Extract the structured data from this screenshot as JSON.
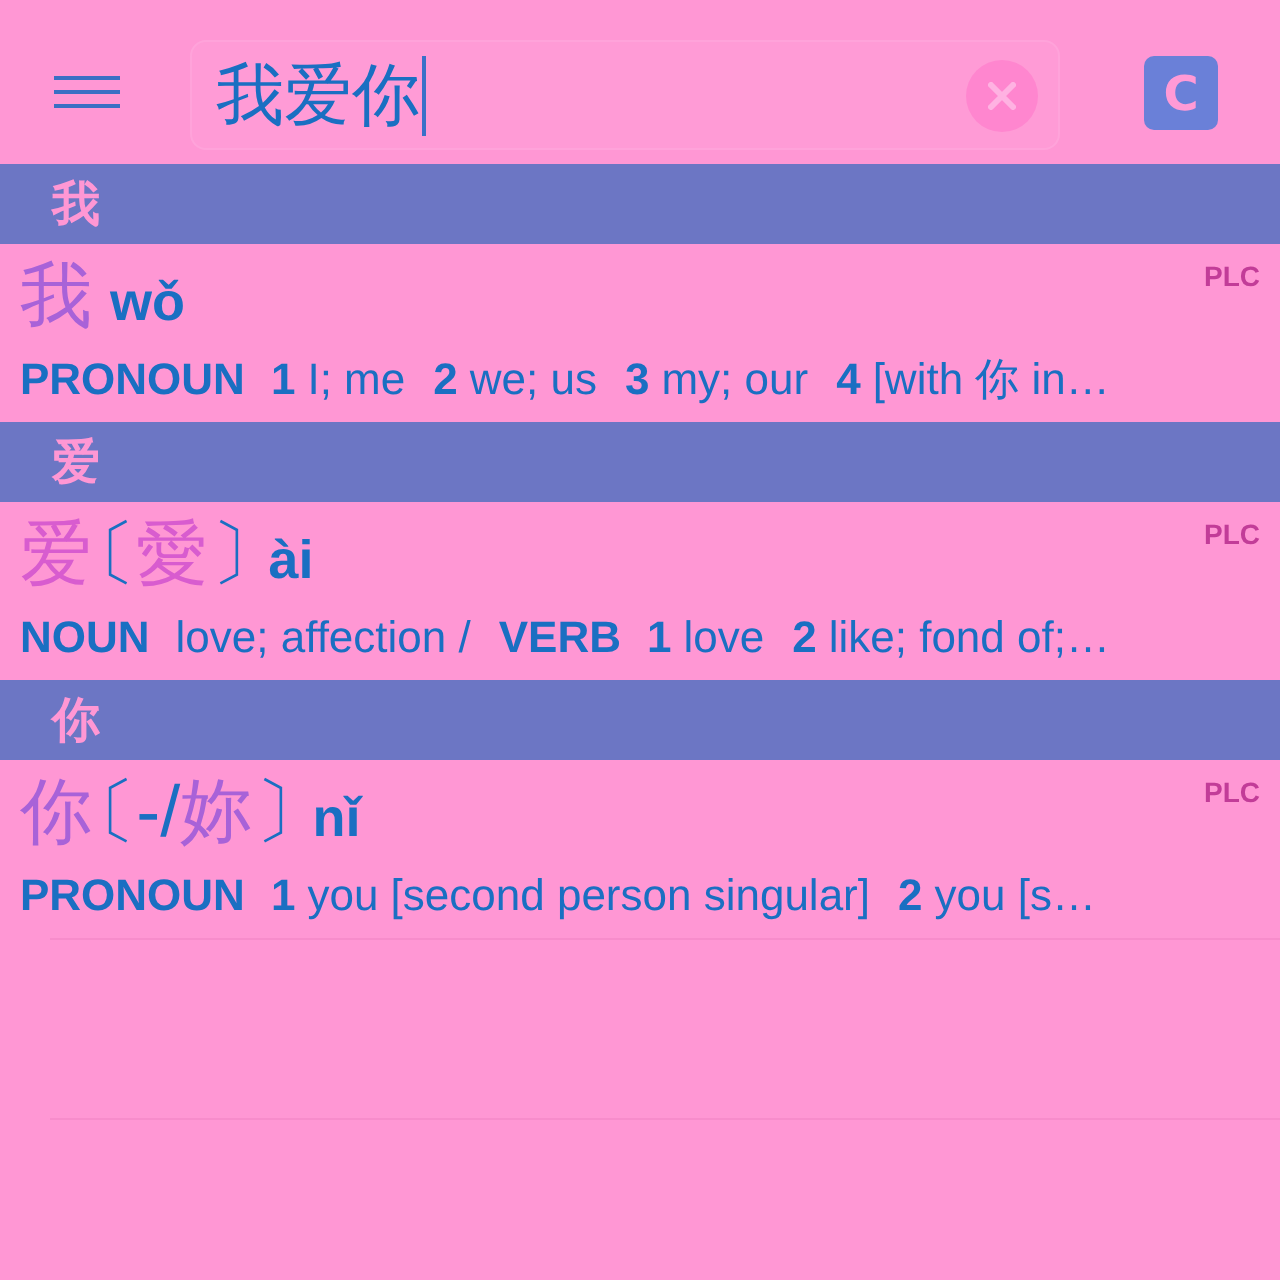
{
  "header": {
    "search": {
      "value": "我爱你",
      "focused": true
    },
    "toggle": {
      "label": "C"
    }
  },
  "sections": [
    {
      "heading": "我",
      "entries": [
        {
          "headword": [
            {
              "kind": "char",
              "text": "我",
              "color": "#a862d8"
            }
          ],
          "pinyin": "wǒ",
          "source": "PLC",
          "definition": [
            {
              "kind": "pos",
              "text": "PRONOUN"
            },
            {
              "kind": "num",
              "text": "1"
            },
            {
              "kind": "gloss",
              "text": "I; me"
            },
            {
              "kind": "num",
              "text": "2"
            },
            {
              "kind": "gloss",
              "text": "we; us"
            },
            {
              "kind": "num",
              "text": "3"
            },
            {
              "kind": "gloss",
              "text": "my; our"
            },
            {
              "kind": "num",
              "text": "4"
            },
            {
              "kind": "gloss",
              "text": "[with 你 in…"
            }
          ]
        }
      ]
    },
    {
      "heading": "爱",
      "entries": [
        {
          "headword": [
            {
              "kind": "char",
              "text": "爱",
              "color": "#d85ccf"
            },
            {
              "kind": "open_bracket",
              "text": "〔",
              "color": "#1a6fc2"
            },
            {
              "kind": "char",
              "text": "愛",
              "color": "#d85ccf"
            },
            {
              "kind": "close_bracket",
              "text": "〕",
              "color": "#1a6fc2"
            }
          ],
          "pinyin": "ài",
          "source": "PLC",
          "definition": [
            {
              "kind": "pos",
              "text": "NOUN"
            },
            {
              "kind": "gloss",
              "text": "love; affection /"
            },
            {
              "kind": "pos",
              "text": "VERB"
            },
            {
              "kind": "num",
              "text": "1"
            },
            {
              "kind": "gloss",
              "text": "love"
            },
            {
              "kind": "num",
              "text": "2"
            },
            {
              "kind": "gloss",
              "text": "like; fond of;…"
            }
          ]
        }
      ]
    },
    {
      "heading": "你",
      "entries": [
        {
          "headword": [
            {
              "kind": "char",
              "text": "你",
              "color": "#a862d8"
            },
            {
              "kind": "open_bracket",
              "text": "〔",
              "color": "#1a6fc2"
            },
            {
              "kind": "char",
              "text": "-/",
              "color": "#1a6fc2"
            },
            {
              "kind": "char",
              "text": "妳",
              "color": "#a862d8"
            },
            {
              "kind": "close_bracket",
              "text": "〕",
              "color": "#1a6fc2"
            }
          ],
          "pinyin": "nǐ",
          "source": "PLC",
          "definition": [
            {
              "kind": "pos",
              "text": "PRONOUN"
            },
            {
              "kind": "num",
              "text": "1"
            },
            {
              "kind": "gloss",
              "text": "you [second person singular]"
            },
            {
              "kind": "num",
              "text": "2"
            },
            {
              "kind": "gloss",
              "text": "you [s…"
            }
          ]
        }
      ]
    }
  ]
}
